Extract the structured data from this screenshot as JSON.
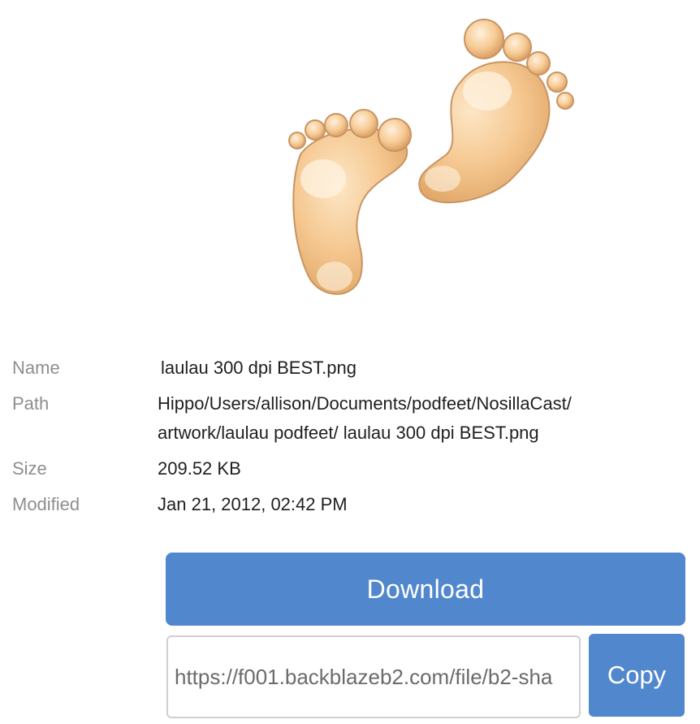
{
  "preview": {
    "icon": "baby-footprints-image",
    "skin_color": "#f3c690",
    "outline_color": "#c4935e"
  },
  "details": {
    "name_label": "Name",
    "name_value": "laulau 300 dpi BEST.png",
    "path_label": "Path",
    "path_line1": "Hippo/Users/allison/Documents/podfeet/NosillaCast/",
    "path_line2": "artwork/laulau podfeet/ laulau 300 dpi BEST.png",
    "size_label": "Size",
    "size_value": "209.52 KB",
    "modified_label": "Modified",
    "modified_value": "Jan 21, 2012, 02:42 PM"
  },
  "actions": {
    "download_label": "Download",
    "share_url": "https://f001.backblazeb2.com/file/b2-sha",
    "copy_label": "Copy",
    "accent_color": "#5187cd"
  }
}
